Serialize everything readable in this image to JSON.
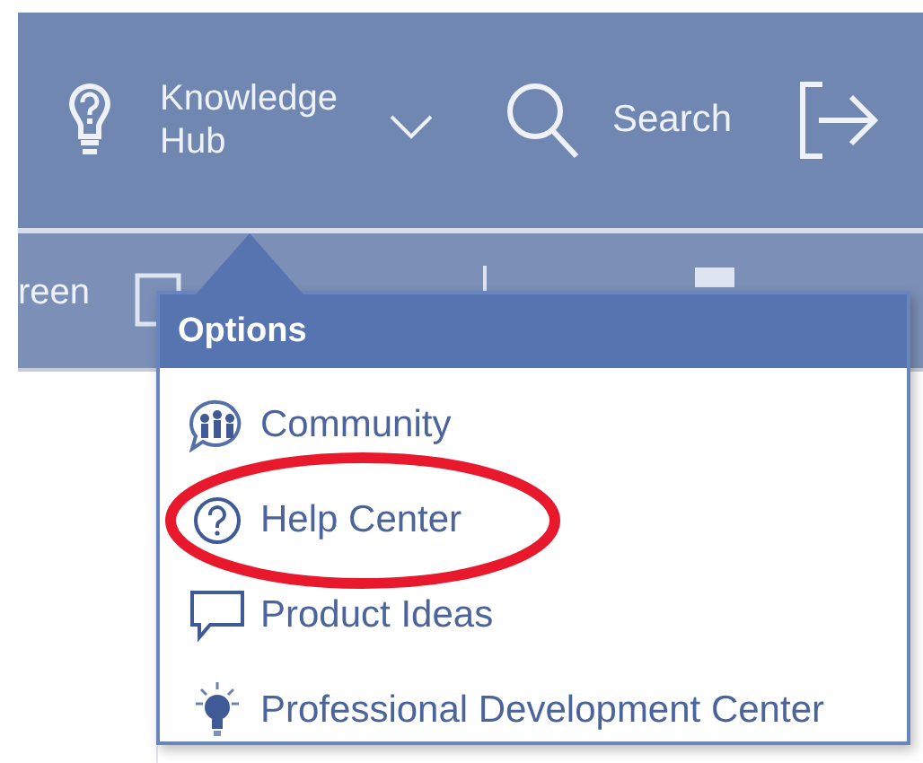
{
  "header": {
    "items": [
      {
        "kind": "menu",
        "label": "Knowledge Hub"
      },
      {
        "kind": "search",
        "label": "Search"
      },
      {
        "kind": "exit"
      }
    ]
  },
  "toolbar": {
    "label": "reen"
  },
  "dropdown": {
    "title": "Options",
    "items": [
      {
        "kind": "community",
        "label": "Community",
        "circled": false
      },
      {
        "kind": "help",
        "label": "Help Center",
        "circled": true
      },
      {
        "kind": "ideas",
        "label": "Product Ideas",
        "circled": false
      },
      {
        "kind": "bulb",
        "label": "Professional Development Center",
        "circled": false
      }
    ]
  }
}
